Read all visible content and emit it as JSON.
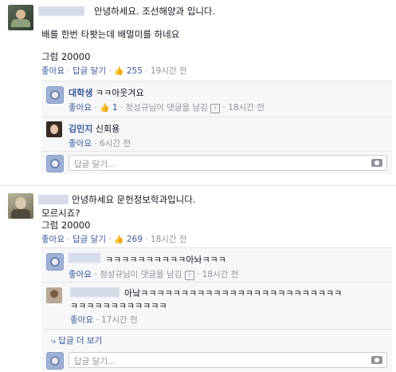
{
  "post1": {
    "author_suffix": "안녕하세요. 조선해양과 입니다.",
    "line2": "배를 한번 타봣는데 배멀미를 하네요",
    "line3": "그럼 20000",
    "like_label": "좋아요",
    "reply_label": "답글 달기",
    "like_count": "255",
    "time": "19시간 전",
    "comments": [
      {
        "name": "대학생",
        "text": "ㅋㅋ아웃겨요",
        "like_label": "좋아요",
        "like_count": "1",
        "reply_note": "정성규님이 댓글을 남김",
        "time": "18시간 전"
      },
      {
        "name": "김민지",
        "text": "신회용",
        "like_label": "좋아요",
        "time": "6시간 전"
      }
    ],
    "reply_placeholder": "답글 달기..."
  },
  "post2": {
    "author_suffix": "안녕하세요 문헌정보학과입니다.",
    "line2": "모르시죠?",
    "line3": "그럼 20000",
    "like_label": "좋아요",
    "reply_label": "답글 달기",
    "like_count": "269",
    "time": "18시간 전",
    "comments": [
      {
        "text": "ㅋㅋㅋㅋㅋㅋㅋㅋㅋㅋ아놔ㅋㅋㅋ",
        "like_label": "좋아요",
        "reply_note": "정성규님이 댓글을 남김",
        "time": "18시간 전"
      },
      {
        "text_line1": "아낰ㅋㅋㅋㅋㅋㅋㅋㅋㅋㅋㅋㅋㅋㅋㅋㅋㅋㅋㅋㅋㅋㅋㅋㅋㅋ",
        "text_line2": "ㅋㅋㅋㅋㅋㅋㅋㅋㅋㅋㅋㅋ",
        "like_label": "좋아요",
        "time": "17시간 전"
      }
    ],
    "more_replies": "답글 더 보기",
    "reply_placeholder": "답글 달기..."
  },
  "icons": {
    "like": "thumbs-up-icon",
    "camera": "camera-icon",
    "reply": "reply-arrow-icon"
  }
}
